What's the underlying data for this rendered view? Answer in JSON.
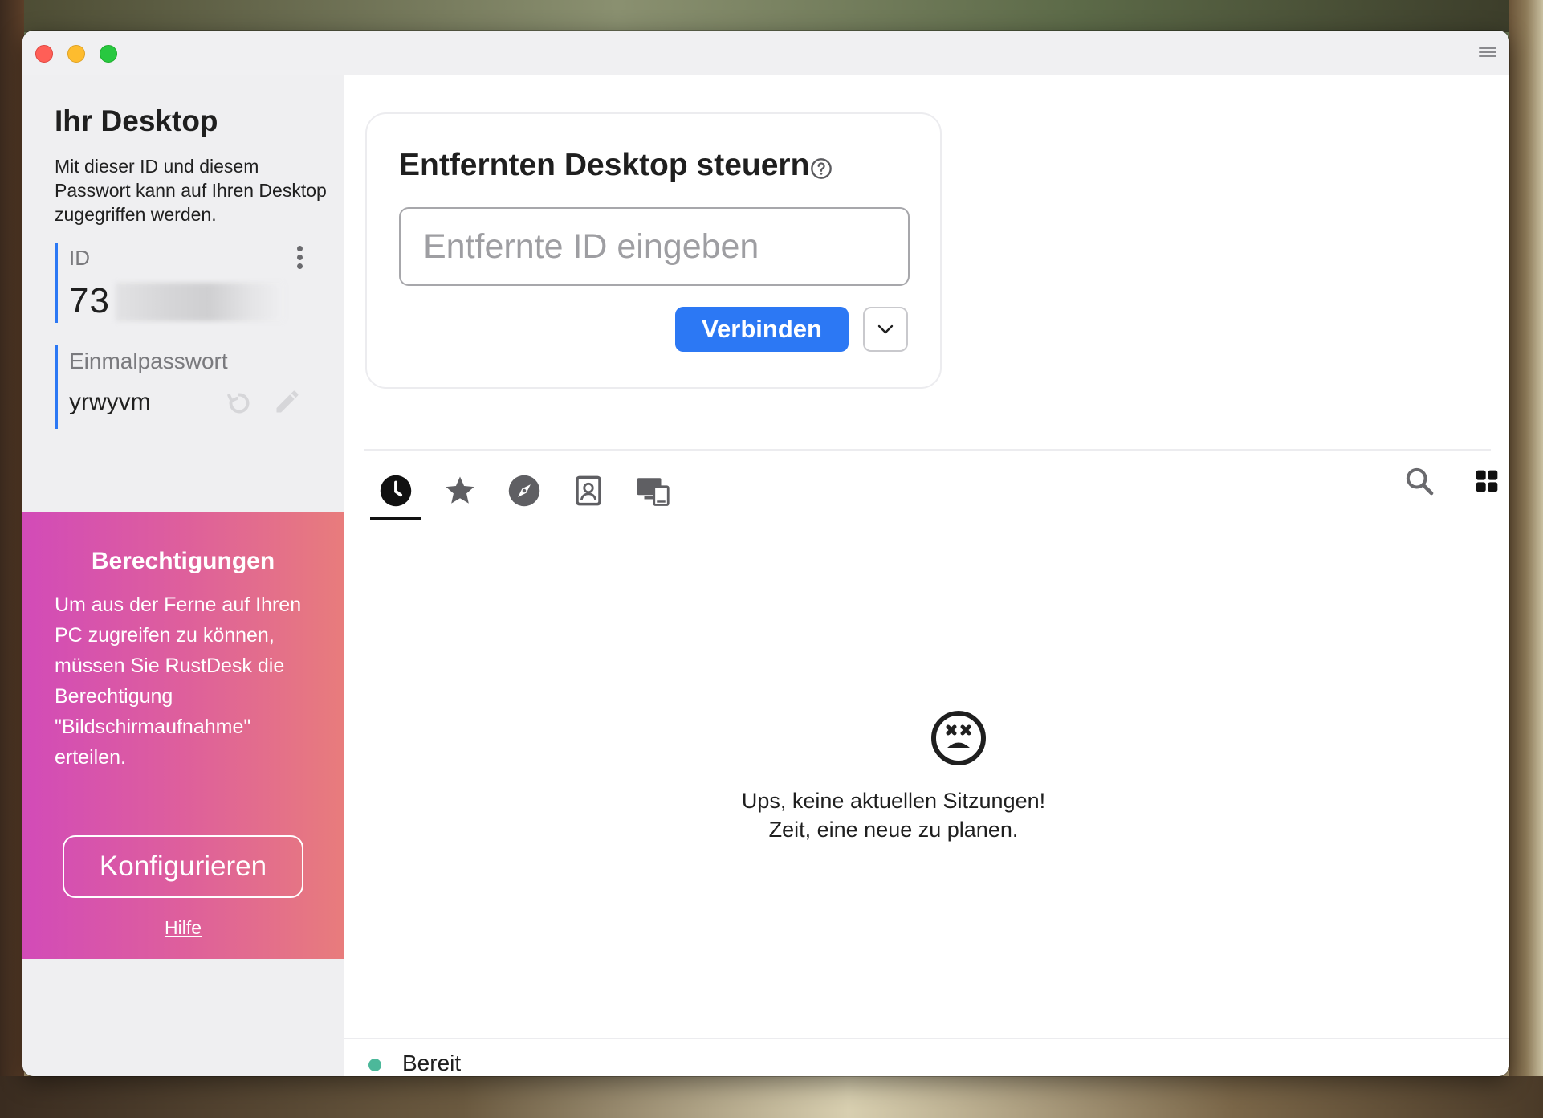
{
  "left_panel": {
    "title": "Ihr Desktop",
    "description": "Mit dieser ID und diesem Passwort kann auf Ihren Desktop zugegriffen werden.",
    "id_label": "ID",
    "id_value": "73",
    "password_label": "Einmalpasswort",
    "password_value": "yrwyvm"
  },
  "permissions": {
    "title": "Berechtigungen",
    "text": "Um aus der Ferne auf Ihren PC zugreifen zu können, müssen Sie RustDesk die Berechtigung \"Bildschirmaufnahme\" erteilen.",
    "configure_label": "Konfigurieren",
    "help_label": "Hilfe",
    "gradient_start": "#d24bb8",
    "gradient_end": "#e87c7c"
  },
  "connect": {
    "title": "Entfernten Desktop steuern",
    "input_placeholder": "Entfernte ID eingeben",
    "input_value": "",
    "connect_label": "Verbinden",
    "accent": "#2c78f4"
  },
  "tabs": [
    {
      "icon": "clock-icon",
      "name": "recent",
      "active": true
    },
    {
      "icon": "star-icon",
      "name": "favorites",
      "active": false
    },
    {
      "icon": "compass-icon",
      "name": "discovered",
      "active": false
    },
    {
      "icon": "address-book-icon",
      "name": "address-book",
      "active": false
    },
    {
      "icon": "devices-icon",
      "name": "group",
      "active": false
    }
  ],
  "tools": [
    "search-icon",
    "grid-view-icon"
  ],
  "empty_state": {
    "icon": "sad-face-icon",
    "line1": "Ups, keine aktuellen Sitzungen!",
    "line2": "Zeit, eine neue zu planen."
  },
  "status": {
    "text": "Bereit",
    "color": "#4cb89a"
  }
}
